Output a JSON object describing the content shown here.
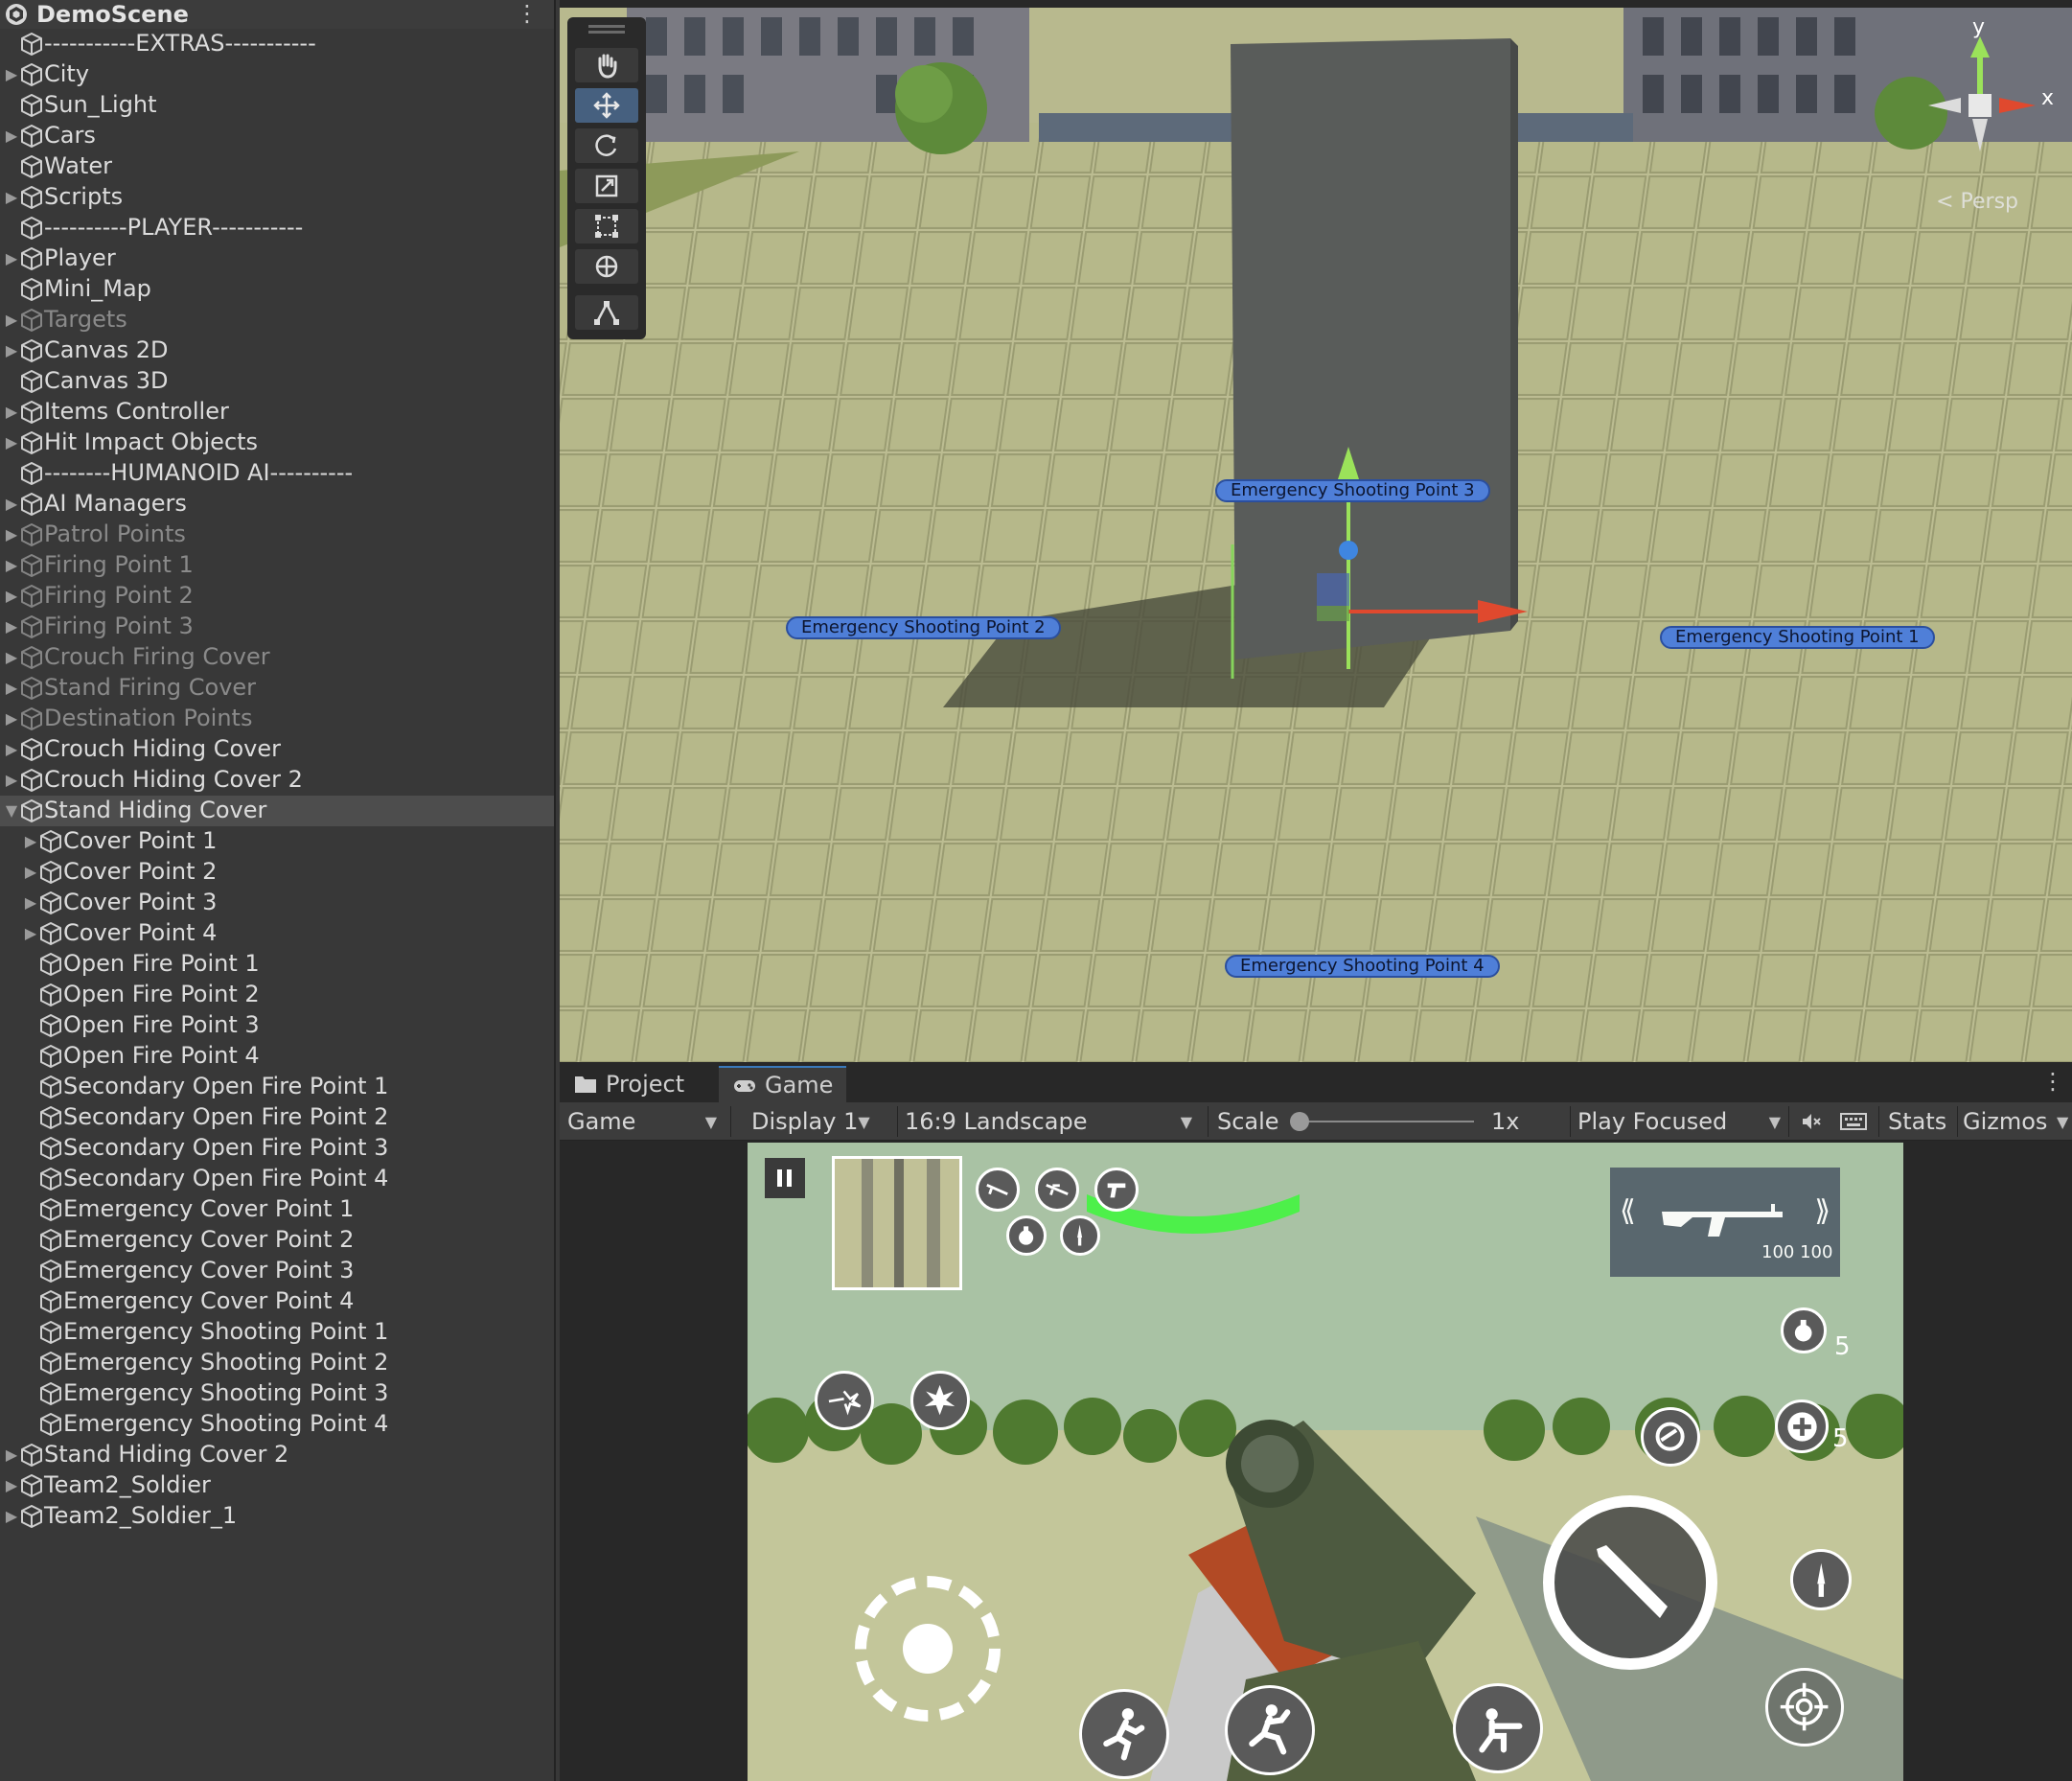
{
  "hierarchy": {
    "scene_name": "DemoScene",
    "items": [
      {
        "label": "-----------EXTRAS-----------",
        "depth": 0,
        "fold": "",
        "active": true,
        "selected": false
      },
      {
        "label": "City",
        "depth": 0,
        "fold": "collapsed",
        "active": true,
        "selected": false
      },
      {
        "label": "Sun_Light",
        "depth": 0,
        "fold": "",
        "active": true,
        "selected": false
      },
      {
        "label": "Cars",
        "depth": 0,
        "fold": "collapsed",
        "active": true,
        "selected": false
      },
      {
        "label": "Water",
        "depth": 0,
        "fold": "",
        "active": true,
        "selected": false
      },
      {
        "label": "Scripts",
        "depth": 0,
        "fold": "collapsed",
        "active": true,
        "selected": false
      },
      {
        "label": "----------PLAYER-----------",
        "depth": 0,
        "fold": "",
        "active": true,
        "selected": false
      },
      {
        "label": "Player",
        "depth": 0,
        "fold": "collapsed",
        "active": true,
        "selected": false
      },
      {
        "label": "Mini_Map",
        "depth": 0,
        "fold": "",
        "active": true,
        "selected": false
      },
      {
        "label": "Targets",
        "depth": 0,
        "fold": "collapsed",
        "active": false,
        "selected": false
      },
      {
        "label": "Canvas 2D",
        "depth": 0,
        "fold": "collapsed",
        "active": true,
        "selected": false
      },
      {
        "label": "Canvas 3D",
        "depth": 0,
        "fold": "",
        "active": true,
        "selected": false
      },
      {
        "label": "Items Controller",
        "depth": 0,
        "fold": "collapsed",
        "active": true,
        "selected": false
      },
      {
        "label": "Hit Impact Objects",
        "depth": 0,
        "fold": "collapsed",
        "active": true,
        "selected": false
      },
      {
        "label": "--------HUMANOID AI----------",
        "depth": 0,
        "fold": "",
        "active": true,
        "selected": false
      },
      {
        "label": "AI Managers",
        "depth": 0,
        "fold": "collapsed",
        "active": true,
        "selected": false
      },
      {
        "label": "Patrol Points",
        "depth": 0,
        "fold": "collapsed",
        "active": false,
        "selected": false
      },
      {
        "label": "Firing Point 1",
        "depth": 0,
        "fold": "collapsed",
        "active": false,
        "selected": false
      },
      {
        "label": "Firing Point 2",
        "depth": 0,
        "fold": "collapsed",
        "active": false,
        "selected": false
      },
      {
        "label": "Firing Point 3",
        "depth": 0,
        "fold": "collapsed",
        "active": false,
        "selected": false
      },
      {
        "label": "Crouch Firing Cover",
        "depth": 0,
        "fold": "collapsed",
        "active": false,
        "selected": false
      },
      {
        "label": "Stand Firing Cover",
        "depth": 0,
        "fold": "collapsed",
        "active": false,
        "selected": false
      },
      {
        "label": "Destination Points",
        "depth": 0,
        "fold": "collapsed",
        "active": false,
        "selected": false
      },
      {
        "label": "Crouch Hiding Cover",
        "depth": 0,
        "fold": "collapsed",
        "active": true,
        "selected": false
      },
      {
        "label": "Crouch Hiding Cover 2",
        "depth": 0,
        "fold": "collapsed",
        "active": true,
        "selected": false
      },
      {
        "label": "Stand Hiding Cover",
        "depth": 0,
        "fold": "expanded",
        "active": true,
        "selected": true
      },
      {
        "label": "Cover Point 1",
        "depth": 1,
        "fold": "collapsed",
        "active": true,
        "selected": false
      },
      {
        "label": "Cover Point 2",
        "depth": 1,
        "fold": "collapsed",
        "active": true,
        "selected": false
      },
      {
        "label": "Cover Point 3",
        "depth": 1,
        "fold": "collapsed",
        "active": true,
        "selected": false
      },
      {
        "label": "Cover Point 4",
        "depth": 1,
        "fold": "collapsed",
        "active": true,
        "selected": false
      },
      {
        "label": "Open Fire Point 1",
        "depth": 1,
        "fold": "",
        "active": true,
        "selected": false
      },
      {
        "label": "Open Fire Point 2",
        "depth": 1,
        "fold": "",
        "active": true,
        "selected": false
      },
      {
        "label": "Open Fire Point 3",
        "depth": 1,
        "fold": "",
        "active": true,
        "selected": false
      },
      {
        "label": "Open Fire Point 4",
        "depth": 1,
        "fold": "",
        "active": true,
        "selected": false
      },
      {
        "label": "Secondary Open Fire Point 1",
        "depth": 1,
        "fold": "",
        "active": true,
        "selected": false
      },
      {
        "label": "Secondary Open Fire Point 2",
        "depth": 1,
        "fold": "",
        "active": true,
        "selected": false
      },
      {
        "label": "Secondary Open Fire Point 3",
        "depth": 1,
        "fold": "",
        "active": true,
        "selected": false
      },
      {
        "label": "Secondary Open Fire Point 4",
        "depth": 1,
        "fold": "",
        "active": true,
        "selected": false
      },
      {
        "label": "Emergency Cover Point 1",
        "depth": 1,
        "fold": "",
        "active": true,
        "selected": false
      },
      {
        "label": "Emergency Cover Point 2",
        "depth": 1,
        "fold": "",
        "active": true,
        "selected": false
      },
      {
        "label": "Emergency Cover Point 3",
        "depth": 1,
        "fold": "",
        "active": true,
        "selected": false
      },
      {
        "label": "Emergency Cover Point 4",
        "depth": 1,
        "fold": "",
        "active": true,
        "selected": false
      },
      {
        "label": "Emergency Shooting Point 1",
        "depth": 1,
        "fold": "",
        "active": true,
        "selected": false
      },
      {
        "label": "Emergency Shooting Point 2",
        "depth": 1,
        "fold": "",
        "active": true,
        "selected": false
      },
      {
        "label": "Emergency Shooting Point 3",
        "depth": 1,
        "fold": "",
        "active": true,
        "selected": false
      },
      {
        "label": "Emergency Shooting Point 4",
        "depth": 1,
        "fold": "",
        "active": true,
        "selected": false
      },
      {
        "label": "Stand Hiding Cover 2",
        "depth": 0,
        "fold": "collapsed",
        "active": true,
        "selected": false
      },
      {
        "label": "Team2_Soldier",
        "depth": 0,
        "fold": "collapsed",
        "active": true,
        "selected": false
      },
      {
        "label": "Team2_Soldier_1",
        "depth": 0,
        "fold": "collapsed",
        "active": true,
        "selected": false
      }
    ]
  },
  "scene": {
    "tools": [
      "hand-tool",
      "move-tool",
      "rotate-tool",
      "scale-tool",
      "rect-tool",
      "transform-tool",
      "custom-tool"
    ],
    "active_tool": "move-tool",
    "gizmo": {
      "y_label": "y",
      "x_label": "x"
    },
    "persp_label": "Persp",
    "point_labels": {
      "p1": "Emergency Shooting Point 1",
      "p2": "Emergency Shooting Point 2",
      "p3": "Emergency Shooting Point 3",
      "p4": "Emergency Shooting Point 4"
    }
  },
  "bottom": {
    "tabs": {
      "project": "Project",
      "game": "Game"
    },
    "active_tab": "Game",
    "toolbar": {
      "game_dropdown": "Game",
      "display": "Display 1",
      "aspect": "16:9 Landscape",
      "scale_label": "Scale",
      "scale_value": "1x",
      "play_mode": "Play Focused",
      "stats": "Stats",
      "gizmos": "Gizmos"
    },
    "hud": {
      "ammo": "100 100",
      "grenade_count": "5",
      "health_count": "5",
      "health_bar_color": "#4df04a"
    }
  },
  "colors": {
    "selection": "#4d4d4d",
    "label_blue": "#4f7fd8",
    "active_tool": "#46607f"
  }
}
